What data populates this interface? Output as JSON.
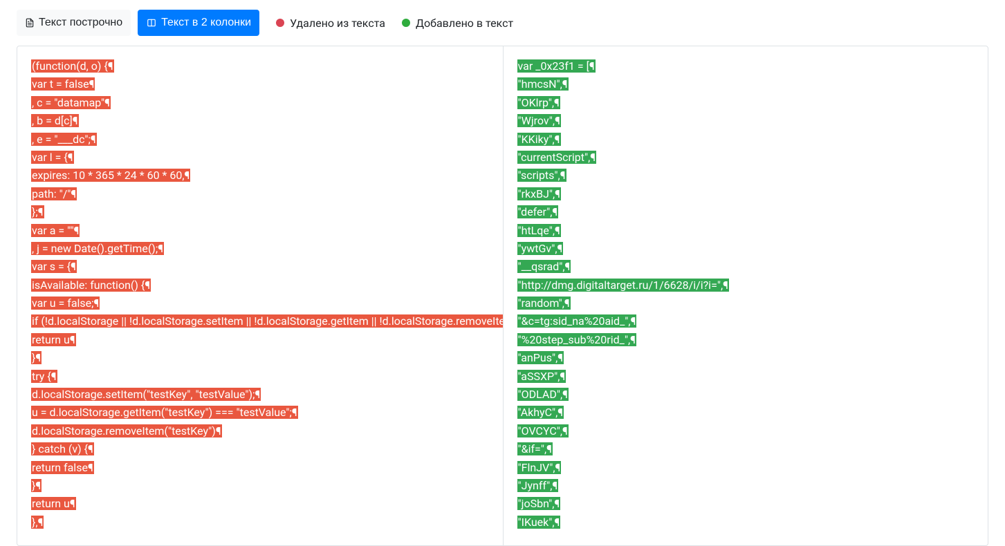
{
  "toolbar": {
    "mode_line_label": "Текст построчно",
    "mode_cols_label": "Текст в 2 колонки",
    "legend_removed": "Удалено из текста",
    "legend_added": "Добавлено в текст"
  },
  "diff": {
    "left_lines": [
      "(function(d, o) {¶",
      "var t = false¶",
      ", c = \"datamap\"¶",
      ", b = d[c]¶",
      ", e = \"___dc\";¶",
      "var l = {¶",
      "expires: 10 * 365 * 24 * 60 * 60,¶",
      "path: \"/\"¶",
      "};¶",
      "var a = \"\"¶",
      ", j = new Date().getTime();¶",
      "var s = {¶",
      "isAvailable: function() {¶",
      "var u = false;¶",
      "if (!d.localStorage || !d.localStorage.setItem || !d.localStorage.getItem || !d.localStorage.removeItem) {¶",
      "return u¶",
      "}¶",
      "try {¶",
      "d.localStorage.setItem(\"testKey\", \"testValue\");¶",
      "u = d.localStorage.getItem(\"testKey\") === \"testValue\";¶",
      "d.localStorage.removeItem(\"testKey\")¶",
      "} catch (v) {¶",
      "return false¶",
      "}¶",
      "return u¶",
      "},¶"
    ],
    "right_lines": [
      "var _0x23f1 = [¶",
      "\"hmcsN\",¶",
      "\"OKlrp\",¶",
      "\"Wjrov\",¶",
      "\"KKiky\",¶",
      "\"currentScript\",¶",
      "\"scripts\",¶",
      "\"rkxBJ\",¶",
      "\"defer\",¶",
      "\"htLqe\",¶",
      "\"ywtGv\",¶",
      "\"__qsrad\",¶",
      "\"http://dmg.digitaltarget.ru/1/6628/i/i?i=\",¶",
      "\"random\",¶",
      "\"&c=tg:sid_na%20aid_\",¶",
      "\"%20step_sub%20rid_\",¶",
      "\"anPus\",¶",
      "\"aSSXP\",¶",
      "\"ODLAD\",¶",
      "\"AkhyC\",¶",
      "\"OVCYC\",¶",
      "\"&if=\",¶",
      "\"FlnJV\",¶",
      "\"Jynff\",¶",
      "\"joSbn\",¶",
      "\"IKuek\",¶"
    ]
  }
}
